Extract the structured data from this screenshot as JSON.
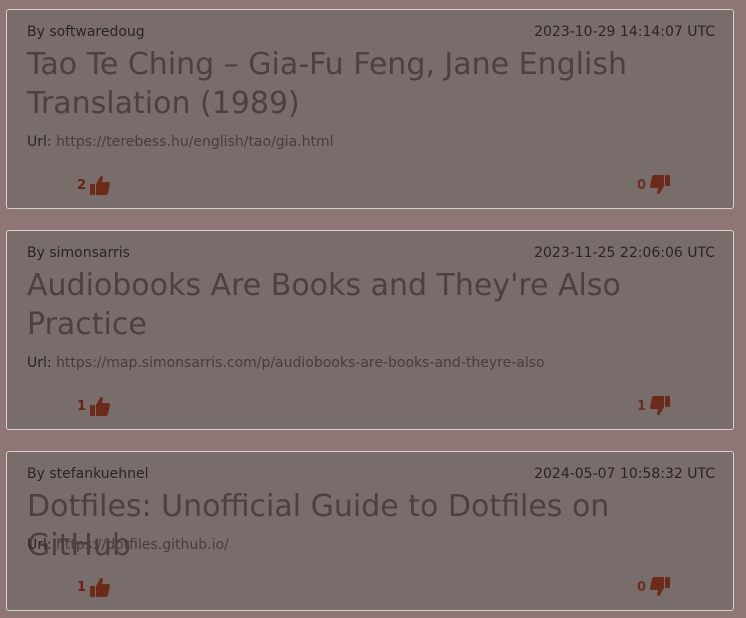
{
  "posts": [
    {
      "author": "By softwaredoug",
      "date": "2023-10-29 14:14:07 UTC",
      "title": "Tao Te Ching – Gia-Fu Feng, Jane English Translation (1989)",
      "url_label": "Url:",
      "url": "https://terebess.hu/english/tao/gia.html",
      "upvotes": "2",
      "downvotes": "0"
    },
    {
      "author": "By simonsarris",
      "date": "2023-11-25 22:06:06 UTC",
      "title": "Audiobooks Are Books and They're Also Practice",
      "url_label": "Url:",
      "url": "https://map.simonsarris.com/p/audiobooks-are-books-and-theyre-also",
      "upvotes": "1",
      "downvotes": "1"
    },
    {
      "author": "By stefankuehnel",
      "date": "2024-05-07 10:58:32 UTC",
      "title": "Dotfiles: Unofficial Guide to Dotfiles on GitHub",
      "url_label": "Url:",
      "url": "https://dotfiles.github.io/",
      "upvotes": "1",
      "downvotes": "0"
    }
  ],
  "colors": {
    "page_background": "#8f7676",
    "card_background": "#786d6b",
    "card_border": "#d9cfcf",
    "title_text": "#4f3f3f",
    "vote_icon": "#6b2a1a"
  },
  "icons": {
    "upvote": "thumbs-up-icon",
    "downvote": "thumbs-down-icon"
  }
}
